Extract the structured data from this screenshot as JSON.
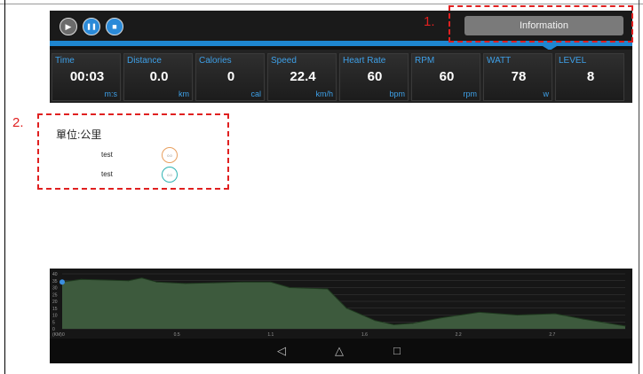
{
  "controls": {
    "play_icon": "▶",
    "pause_icon": "❚❚",
    "stop_icon": "■",
    "information_label": "Information"
  },
  "metrics": [
    {
      "label": "Time",
      "value": "00:03",
      "unit": "m:s"
    },
    {
      "label": "Distance",
      "value": "0.0",
      "unit": "km"
    },
    {
      "label": "Calories",
      "value": "0",
      "unit": "cal"
    },
    {
      "label": "Speed",
      "value": "22.4",
      "unit": "km/h"
    },
    {
      "label": "Heart Rate",
      "value": "60",
      "unit": "bpm"
    },
    {
      "label": "RPM",
      "value": "60",
      "unit": "rpm"
    },
    {
      "label": "WATT",
      "value": "78",
      "unit": "w"
    },
    {
      "label": "LEVEL",
      "value": "8",
      "unit": ""
    }
  ],
  "content": {
    "unit_title": "單位:公里",
    "legend": [
      {
        "label": "test",
        "circle_text": "0.0",
        "color": "#e8a060"
      },
      {
        "label": "test",
        "circle_text": "0.0",
        "color": "#2fb3b3"
      }
    ]
  },
  "chart_data": {
    "type": "area",
    "x_unit_label": "(KM)",
    "x_ticks": [
      "0",
      "0.5",
      "1.1",
      "1.6",
      "2.2",
      "2.7"
    ],
    "y_ticks": [
      "0",
      "5",
      "10",
      "15",
      "20",
      "25",
      "30",
      "35",
      "40"
    ],
    "ylim": [
      0,
      40
    ],
    "xlim": [
      0,
      2.97
    ],
    "fill_color": "#3d5a3d",
    "line_color": "#1f3a1f",
    "marker_color": "#3b8fe0",
    "x": [
      0,
      0.1,
      0.35,
      0.42,
      0.5,
      0.65,
      0.8,
      0.95,
      1.1,
      1.2,
      1.4,
      1.5,
      1.65,
      1.75,
      1.85,
      2.0,
      2.2,
      2.4,
      2.6,
      2.75,
      2.97
    ],
    "values": [
      34,
      36,
      35,
      37,
      34,
      33,
      33.5,
      34,
      34,
      30,
      29,
      15,
      6,
      3,
      4,
      8,
      12,
      10,
      11,
      7,
      2
    ]
  },
  "navbar": {
    "back_icon": "◁",
    "home_icon": "△",
    "recents_icon": "□"
  },
  "annotations": [
    {
      "label": "1."
    },
    {
      "label": "2."
    }
  ]
}
